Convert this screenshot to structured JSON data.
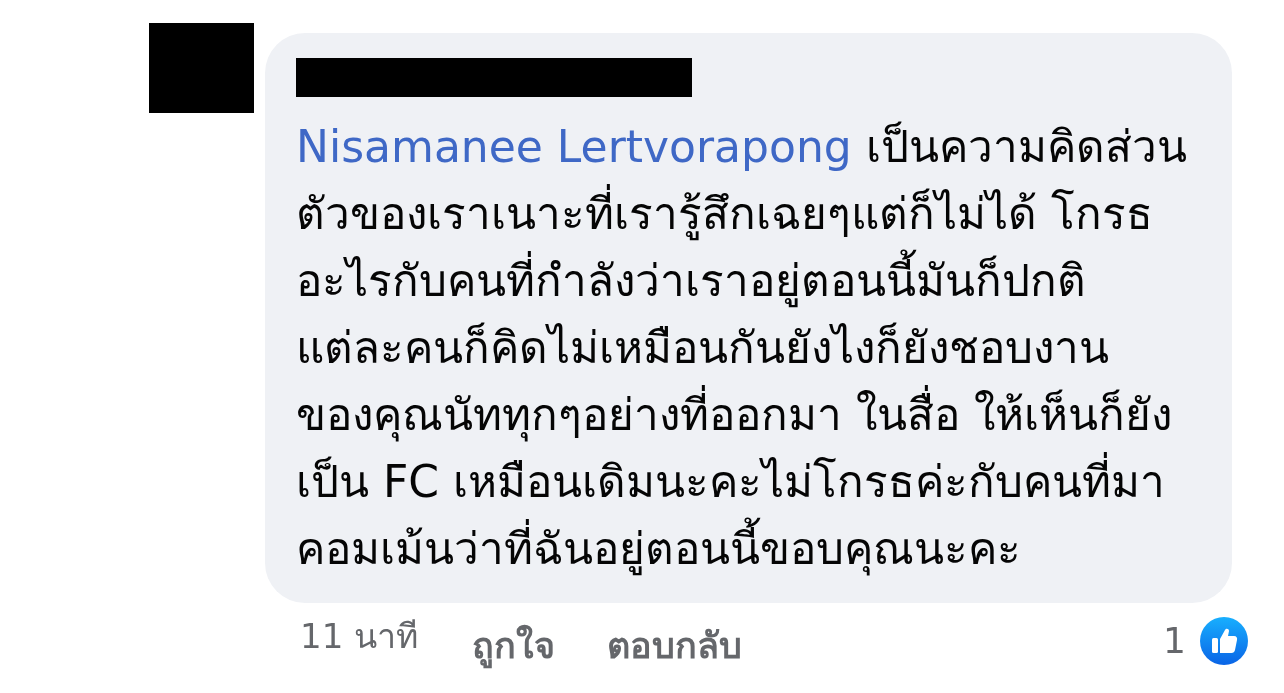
{
  "comment": {
    "mention": "Nisamanee Lertvorapong",
    "text_lines": [
      "เป็นความคิดส่วน",
      "ตัวของเราเนาะที่เรารู้สึกเฉยๆแต่ก็ไม่ได้ โกรธ",
      "อะไรกับคนที่กำลังว่าเราอยู่ตอนนี้มันก็ปกติ",
      "แต่ละคนก็คิดไม่เหมือนกันยังไงก็ยังชอบงาน",
      "ของคุณนัททุกๆอย่างที่ออกมา ในสื่อ ให้เห็นก็ยัง",
      "เป็น FC เหมือนเดิมนะคะไม่โกรธค่ะกับคนที่มา",
      "คอมเม้นว่าที่ฉันอยู่ตอนนี้ขอบคุณนะคะ"
    ]
  },
  "footer": {
    "time": "11 นาที",
    "actions": [
      "ถูกใจ",
      "ตอบกลับ"
    ],
    "reaction_count": "1"
  }
}
